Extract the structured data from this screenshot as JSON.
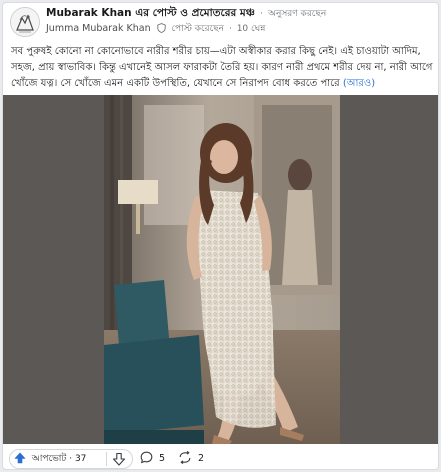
{
  "post": {
    "group_name": "Mubarak Khan এর পোস্ট ও প্রমোতরের মঞ্চ",
    "join_label": "অনুসরণ করছেন",
    "author": "Jumma Mubarak Khan",
    "author_role": "পোস্ট করেছেন",
    "time_ago": "10 ঘেন্ন",
    "body": "সব পুরুষই কোনো না কোনোভাবে নারীর শরীর চায়—এটা অস্বীকার করার কিছু নেই। এই চাওয়াটা আদিম, সহজ, প্রায় স্বাভাবিক। কিন্তু এখানেই আসল ফারাকটা তৈরি হয়। কারণ নারী প্রথমে শরীর দেয় না, নারী আগে খোঁজে যত্ন। সে খোঁজে এমন একটি উপস্থিতি, যেখানে সে নিরাপদ বোধ করতে পারে",
    "more_label": "(আরও)"
  },
  "actions": {
    "upvote_label": "আপভোট",
    "upvote_count": "37",
    "comment_count": "5",
    "share_count": "2"
  },
  "icons": {
    "avatar": "avatar-illustration",
    "shield": "shield-icon",
    "upvote": "arrow-up-icon",
    "downvote": "arrow-down-icon",
    "comment": "comment-bubble-icon",
    "share": "repost-arrows-icon"
  },
  "colors": {
    "link": "#2a6fd6",
    "meta_text": "#6b6f73",
    "photo_backdrop": "#5b5855"
  }
}
